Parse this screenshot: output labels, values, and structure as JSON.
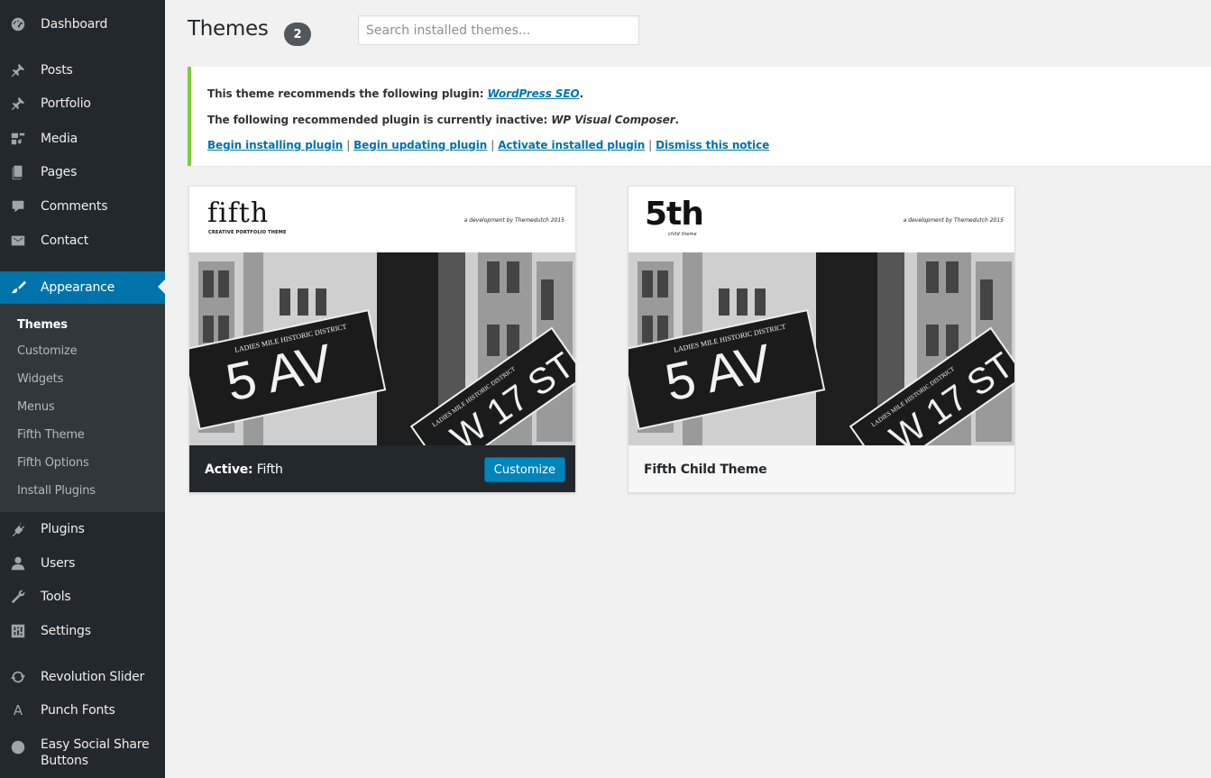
{
  "sidebar": {
    "items": [
      {
        "label": "Dashboard",
        "icon": "dashboard-icon"
      },
      {
        "label": "Posts",
        "icon": "pin-icon"
      },
      {
        "label": "Portfolio",
        "icon": "pin-icon"
      },
      {
        "label": "Media",
        "icon": "media-icon"
      },
      {
        "label": "Pages",
        "icon": "pages-icon"
      },
      {
        "label": "Comments",
        "icon": "comment-icon"
      },
      {
        "label": "Contact",
        "icon": "envelope-icon"
      },
      {
        "label": "Appearance",
        "icon": "paintbrush-icon",
        "active": true
      },
      {
        "label": "Plugins",
        "icon": "plug-icon"
      },
      {
        "label": "Users",
        "icon": "users-icon"
      },
      {
        "label": "Tools",
        "icon": "wrench-icon"
      },
      {
        "label": "Settings",
        "icon": "settings-icon"
      },
      {
        "label": "Revolution Slider",
        "icon": "refresh-icon"
      },
      {
        "label": "Punch Fonts",
        "icon": "font-icon"
      },
      {
        "label": "Easy Social Share Buttons",
        "icon": "share-icon"
      }
    ],
    "submenu": [
      {
        "label": "Themes",
        "current": true
      },
      {
        "label": "Customize"
      },
      {
        "label": "Widgets"
      },
      {
        "label": "Menus"
      },
      {
        "label": "Fifth Theme"
      },
      {
        "label": "Fifth Options"
      },
      {
        "label": "Install Plugins"
      }
    ]
  },
  "header": {
    "title": "Themes",
    "count": "2",
    "search_placeholder": "Search installed themes..."
  },
  "notice": {
    "line1_prefix": "This theme recommends the following plugin: ",
    "line1_plugin": "WordPress SEO",
    "line1_suffix": ".",
    "line2_prefix": "The following recommended plugin is currently inactive: ",
    "line2_plugin": "WP Visual Composer",
    "line2_suffix": ".",
    "actions": [
      "Begin installing plugin",
      "Begin updating plugin",
      "Activate installed plugin",
      "Dismiss this notice"
    ],
    "separator": "|"
  },
  "themes": [
    {
      "logo": "fifth",
      "tagline": "CREATIVE PORTFOLIO THEME",
      "credit": "a development by Themedutch 2015",
      "status_label": "Active:",
      "name": "Fifth",
      "button": "Customize",
      "sign_big": "5 AV",
      "sign_small": "LADIES MILE HISTORIC DISTRICT",
      "sign_cross": "W 17 ST",
      "sign_cross_small": "LADIES MILE HISTORIC DISTRICT"
    },
    {
      "logo": "5th",
      "tagline": "child theme",
      "credit": "a development by Themedutch 2015",
      "name": "Fifth Child Theme",
      "sign_big": "5 AV",
      "sign_small": "LADIES MILE HISTORIC DISTRICT",
      "sign_cross": "W 17 ST",
      "sign_cross_small": "LADIES MILE HISTORIC DISTRICT"
    }
  ],
  "colors": {
    "sidebar_bg": "#23282d",
    "submenu_bg": "#32373c",
    "active_blue": "#0073aa",
    "notice_border": "#7ad03a",
    "button_blue": "#0085ba"
  }
}
